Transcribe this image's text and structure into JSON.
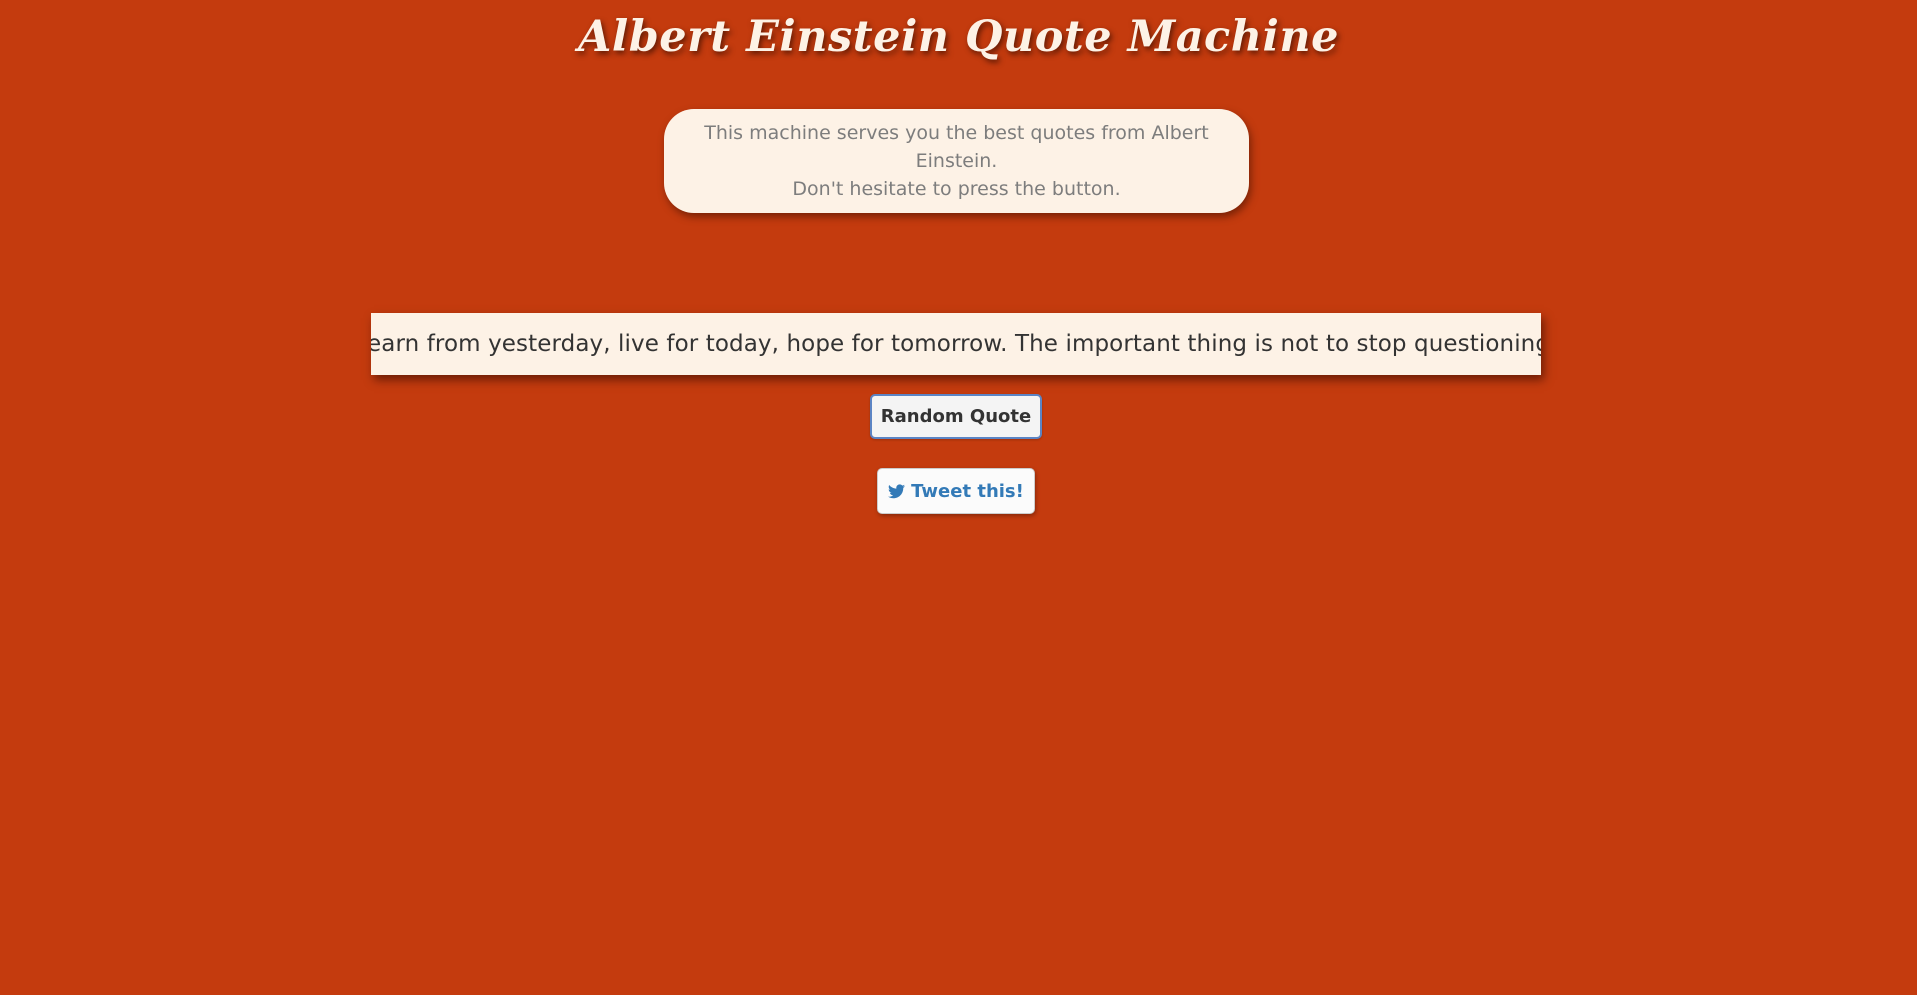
{
  "page": {
    "title": "Albert Einstein Quote Machine",
    "background_color": "#c43b0e"
  },
  "intro": {
    "line1": "This machine serves you the best quotes from Albert Einstein.",
    "line2": "Don't hesitate to press the button."
  },
  "quote": {
    "text": "\"Learn from yesterday, live for today, hope for tomorrow. The important thing is not to stop questioning.\""
  },
  "buttons": {
    "random_label": "Random Quote",
    "tweet_label": "Tweet this!",
    "tweet_icon": "twitter-icon",
    "tweet_color": "#337ab7"
  }
}
